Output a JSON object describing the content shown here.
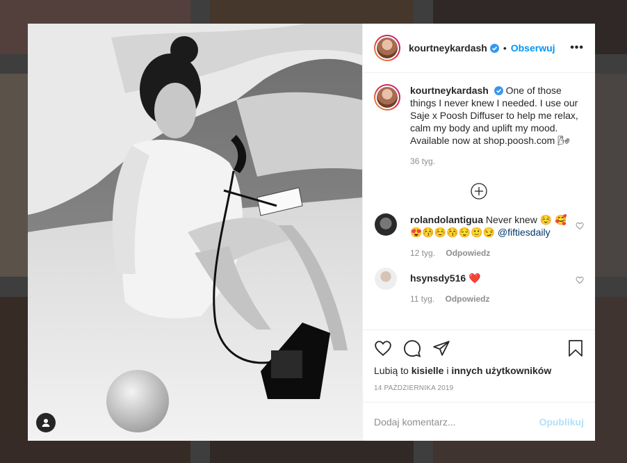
{
  "post": {
    "author": "kourtneykardash",
    "follow_label": "Obserwuj",
    "separator": "•",
    "more_label": "•••",
    "caption": "One of those things I never knew I needed. I use our Saje x Poosh Diffuser to help me relax, calm my body and uplift my mood. Available now at shop.poosh.com 🌬",
    "caption_time": "36 tyg.",
    "date": "14 PAŹDZIERNIKA 2019",
    "likes_prefix": "Lubią to",
    "likes_user": "kisielle",
    "likes_and": "i",
    "likes_others": "innych użytkowników"
  },
  "comments": [
    {
      "user": "rolandolantigua",
      "text": "Never knew ☺️ 🥰😍😚☺️😚😌🙂😏",
      "mention": "@fiftiesdaily",
      "time": "12 tyg.",
      "reply": "Odpowiedz"
    },
    {
      "user": "hsynsdy516",
      "text": "❤️",
      "mention": "",
      "time": "11 tyg.",
      "reply": "Odpowiedz"
    }
  ],
  "composer": {
    "placeholder": "Dodaj komentarz...",
    "post_label": "Opublikuj"
  },
  "colors": {
    "accent": "#0095f6",
    "post_disabled": "#b2dffc",
    "like_heart": "#ed4956"
  }
}
